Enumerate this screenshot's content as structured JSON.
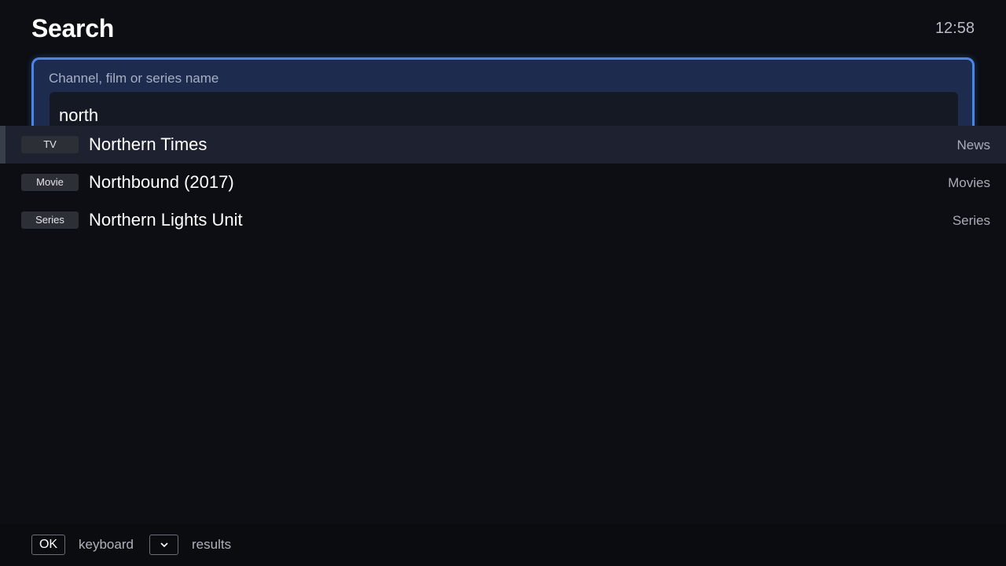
{
  "header": {
    "title": "Search",
    "clock": "12:58"
  },
  "search": {
    "label": "Channel, film or series name",
    "value": "north"
  },
  "results": [
    {
      "type": "TV",
      "title": "Northern Times",
      "category": "News",
      "selected": true
    },
    {
      "type": "Movie",
      "title": "Northbound (2017)",
      "category": "Movies",
      "selected": false
    },
    {
      "type": "Series",
      "title": "Northern Lights Unit",
      "category": "Series",
      "selected": false
    }
  ],
  "footer": {
    "ok_key": "OK",
    "ok_action": "keyboard",
    "down_key_icon": "chevron-down-icon",
    "down_action": "results"
  },
  "colors": {
    "accent": "#4a86e8",
    "background": "#0c0e14",
    "selected_row": "#1e2230"
  }
}
